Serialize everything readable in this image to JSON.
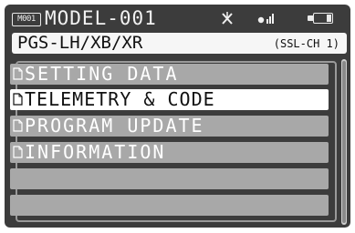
{
  "status_bar": {
    "model_badge": "M001",
    "model_name": "MODEL-001",
    "icons": [
      "antenna-x-icon",
      "signal-icon",
      "battery-icon"
    ],
    "battery_level": 0.25
  },
  "protocol": {
    "name": "PGS-LH/XB/XR",
    "channel": "(SSL-CH 1)"
  },
  "menu": {
    "items": [
      {
        "label": "SETTING DATA",
        "selected": false
      },
      {
        "label": "TELEMETRY & CODE",
        "selected": true
      },
      {
        "label": "PROGRAM UPDATE",
        "selected": false
      },
      {
        "label": "INFORMATION",
        "selected": false
      },
      {
        "label": "",
        "selected": false
      },
      {
        "label": "",
        "selected": false
      }
    ]
  },
  "colors": {
    "background": "#3c3c3c",
    "menu_item": "#a8a8a8",
    "menu_item_selected": "#ffffff",
    "text_light": "#ffffff",
    "text_dark": "#111111"
  }
}
